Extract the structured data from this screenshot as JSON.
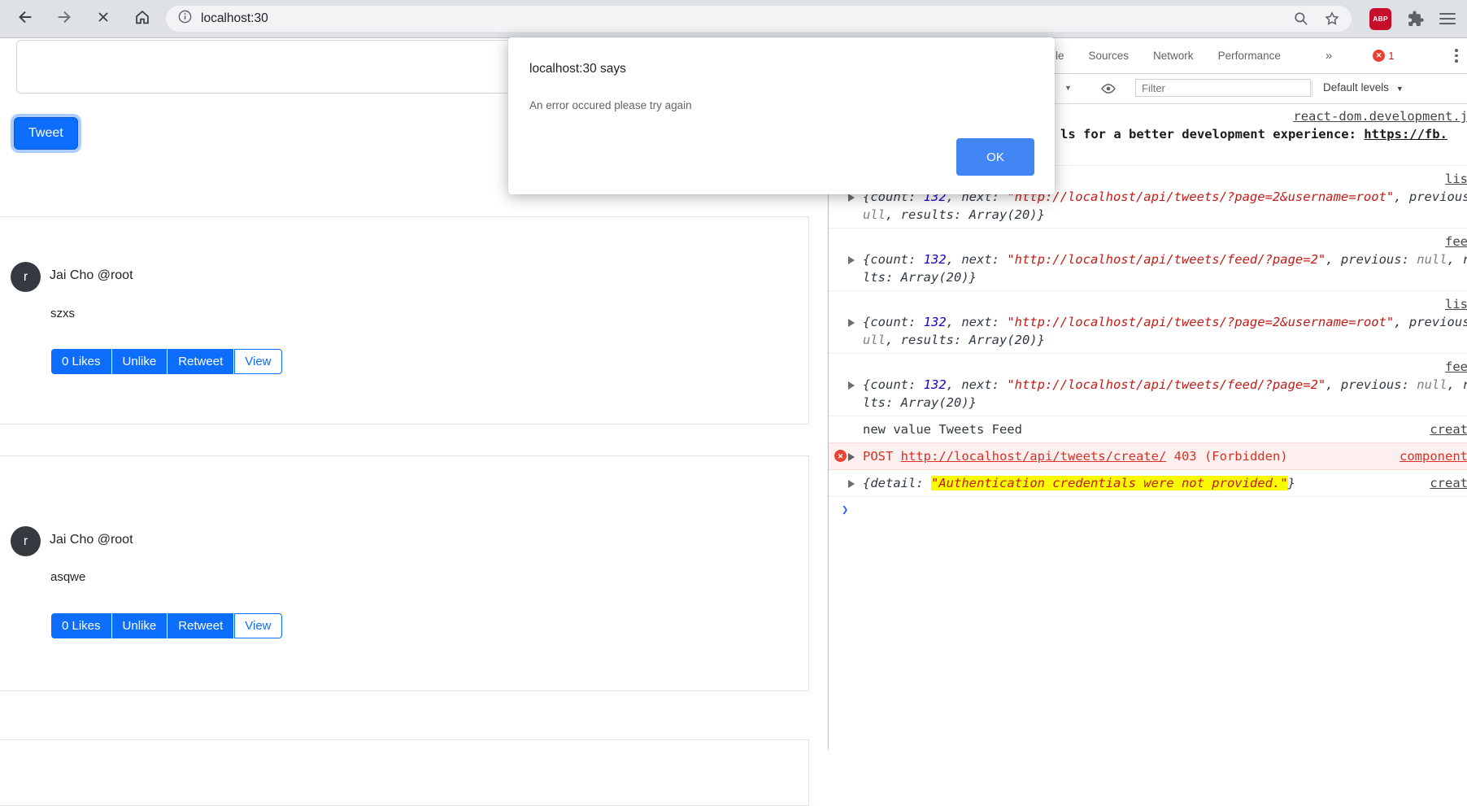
{
  "browser": {
    "url": "localhost:30",
    "abp_label": "ABP"
  },
  "dialog": {
    "title": "localhost:30 says",
    "message": "An error occured please try again",
    "ok_label": "OK"
  },
  "page": {
    "tweet_button": "Tweet",
    "tweets": [
      {
        "avatar_initial": "r",
        "author": "Jai Cho @root",
        "content": "szxs",
        "likes_label": "0 Likes",
        "unlike_label": "Unlike",
        "retweet_label": "Retweet",
        "view_label": "View"
      },
      {
        "avatar_initial": "r",
        "author": "Jai Cho @root",
        "content": "asqwe",
        "likes_label": "0 Likes",
        "unlike_label": "Unlike",
        "retweet_label": "Retweet",
        "view_label": "View"
      }
    ]
  },
  "devtools": {
    "tabs": {
      "console_partial": "le",
      "sources": "Sources",
      "network": "Network",
      "performance": "Performance",
      "more_tabs": "»",
      "error_icon_glyph": "✕",
      "error_count": "1"
    },
    "toolbar": {
      "context_arrow": "▼",
      "filter_placeholder": "Filter",
      "levels_label": "Default levels",
      "levels_arrow": "▼"
    },
    "console": {
      "react_row": {
        "text": "ls for a better development experience: ",
        "link_text": "https://fb.",
        "source": "react-dom.development.j"
      },
      "list_row": {
        "source": "lis",
        "p_open": "{count: ",
        "count": "132",
        "p_next": ", next: ",
        "next_url": "\"http://localhost/api/tweets/?page=2&username=root\"",
        "p_prev": ", previous: ",
        "prev_val": "null",
        "p_results": ", results: ",
        "results_val": "Array(20)",
        "p_close": "}"
      },
      "feed_row": {
        "source": "fee",
        "p_open": "{count: ",
        "count": "132",
        "p_next": ", next: ",
        "next_url": "\"http://localhost/api/tweets/feed/?page=2\"",
        "p_prev": ", previous: ",
        "prev_val": "null",
        "p_results": ", results: ",
        "results_val": "Array(20)",
        "p_close": "}"
      },
      "log_row": {
        "text": "new value Tweets Feed",
        "source": "creat"
      },
      "error_row": {
        "icon_glyph": "✕",
        "method": "POST ",
        "url": "http://localhost/api/tweets/create/",
        "status": " 403 (Forbidden)",
        "source": "component"
      },
      "detail_row": {
        "p_open": "{detail: ",
        "value": "\"Authentication credentials were not provided.\"",
        "p_close": "}",
        "source": "creat"
      },
      "prompt_glyph": "❯"
    }
  },
  "colors": {
    "accent_blue": "#0d6efd",
    "dialog_ok_blue": "#4285f4",
    "error_red": "#d93025",
    "error_bg": "#fff0f0",
    "highlight_yellow": "#fbfb00",
    "number_blue": "#1c00cf",
    "string_red": "#c41a16",
    "avatar_dark": "#343a40"
  }
}
